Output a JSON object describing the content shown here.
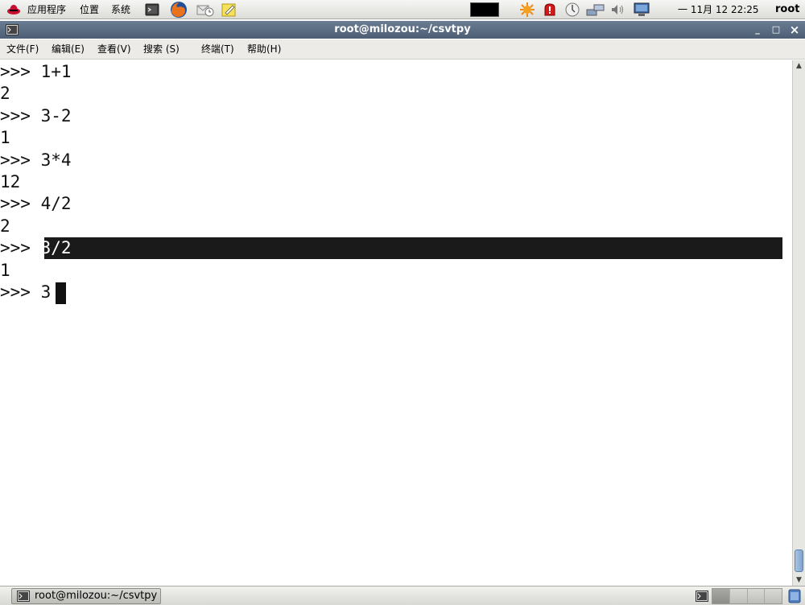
{
  "top_panel": {
    "menus": [
      "应用程序",
      "位置",
      "系统"
    ],
    "clock": "一 11月 12 22:25",
    "user": "root"
  },
  "window": {
    "title": "root@milozou:~/csvtpy",
    "minimize": "_",
    "maximize": "□",
    "close": "×"
  },
  "menubar": {
    "file": "文件(F)",
    "edit": "编辑(E)",
    "view": "查看(V)",
    "search": "搜索 (S)",
    "terminal": "终端(T)",
    "help": "帮助(H)"
  },
  "terminal": {
    "prompt": ">>> ",
    "lines": [
      {
        "type": "input",
        "text": "1+1"
      },
      {
        "type": "output",
        "text": "2"
      },
      {
        "type": "input",
        "text": "3-2"
      },
      {
        "type": "output",
        "text": "1"
      },
      {
        "type": "input",
        "text": "3*4"
      },
      {
        "type": "output",
        "text": "12"
      },
      {
        "type": "input",
        "text": "4/2"
      },
      {
        "type": "output",
        "text": "2"
      },
      {
        "type": "input",
        "text": "3/2",
        "highlighted": true
      },
      {
        "type": "output",
        "text": "1"
      },
      {
        "type": "input",
        "text": "3",
        "current": true
      }
    ]
  },
  "taskbar": {
    "task_label": "root@milozou:~/csvtpy"
  },
  "colors": {
    "titlebar": "#5a6b80",
    "highlight": "#1a1a1a",
    "scroll_thumb": "#7fa3cf"
  }
}
